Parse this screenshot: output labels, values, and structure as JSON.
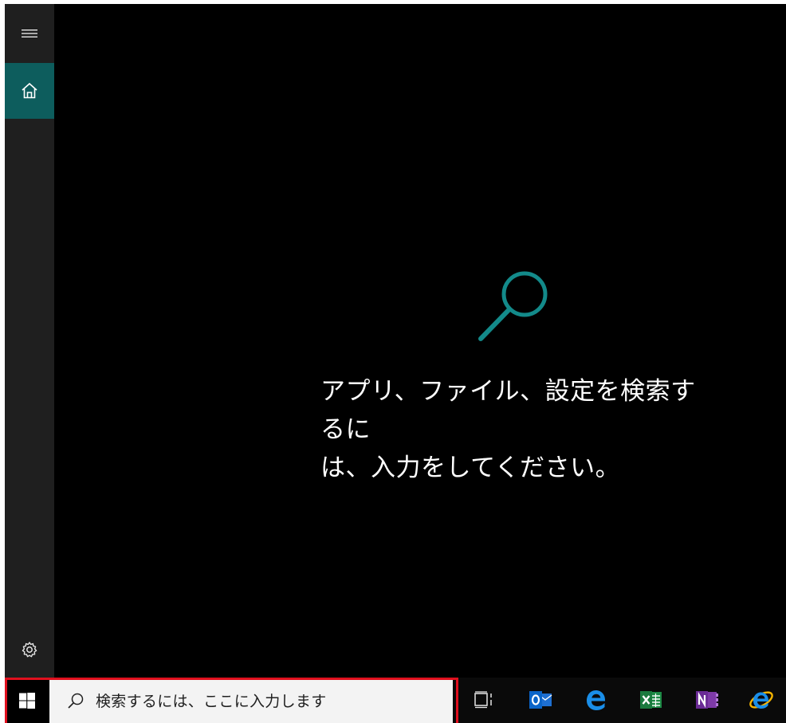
{
  "rail": {
    "menu_icon": "hamburger-icon",
    "home_icon": "home-icon",
    "settings_icon": "gear-icon",
    "accent": "#0d5d5d"
  },
  "main": {
    "hint_line1": "アプリ、ファイル、設定を検索するに",
    "hint_line2": "は、入力をしてください。",
    "hint_icon": "search-icon",
    "icon_color": "#138a8a"
  },
  "taskbar": {
    "search_placeholder": "検索するには、ここに入力します",
    "highlight_color": "#e0101e",
    "apps": [
      {
        "name": "task-view",
        "icon": "task-view-icon"
      },
      {
        "name": "outlook",
        "icon": "outlook-icon"
      },
      {
        "name": "edge",
        "icon": "edge-icon"
      },
      {
        "name": "excel",
        "icon": "excel-icon"
      },
      {
        "name": "onenote",
        "icon": "onenote-icon"
      },
      {
        "name": "internet-explorer",
        "icon": "internet-explorer-icon"
      }
    ]
  }
}
